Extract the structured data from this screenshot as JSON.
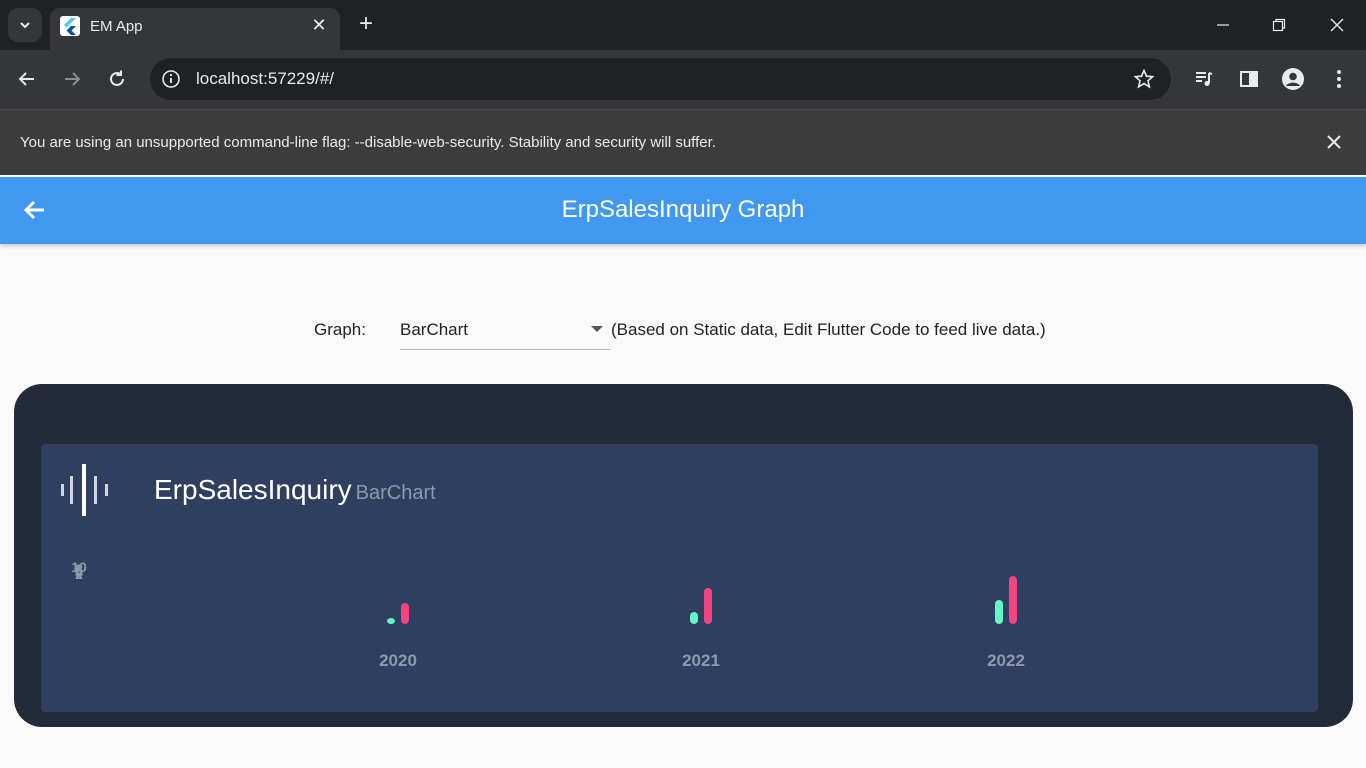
{
  "browser": {
    "tab_title": "EM App",
    "url": "localhost:57229/#/",
    "infobar_message": "You are using an unsupported command-line flag: --disable-web-security. Stability and security will suffer."
  },
  "app": {
    "title": "ErpSalesInquiry Graph",
    "graph_label": "Graph:",
    "graph_selected": "BarChart",
    "graph_note": "(Based on Static data, Edit Flutter Code to feed live data.)"
  },
  "chart_panel": {
    "title": "ErpSalesInquiry",
    "subtitle": "BarChart"
  },
  "colors": {
    "appbar": "#4198f1",
    "series_a": "#64f5c9",
    "series_b": "#f0457f",
    "panel_outer": "#232a39",
    "panel_inner": "#2f3f5f"
  },
  "chart_data": {
    "type": "bar",
    "categories": [
      "2020",
      "2021",
      "2022"
    ],
    "ylim": [
      0,
      10
    ],
    "y_ticks": [
      "0",
      "2",
      "4",
      "6",
      "8",
      "10"
    ],
    "series": [
      {
        "values": [
          1,
          2,
          4
        ]
      },
      {
        "values": [
          3.5,
          6,
          8
        ]
      }
    ],
    "legend": "none",
    "grid": false
  }
}
